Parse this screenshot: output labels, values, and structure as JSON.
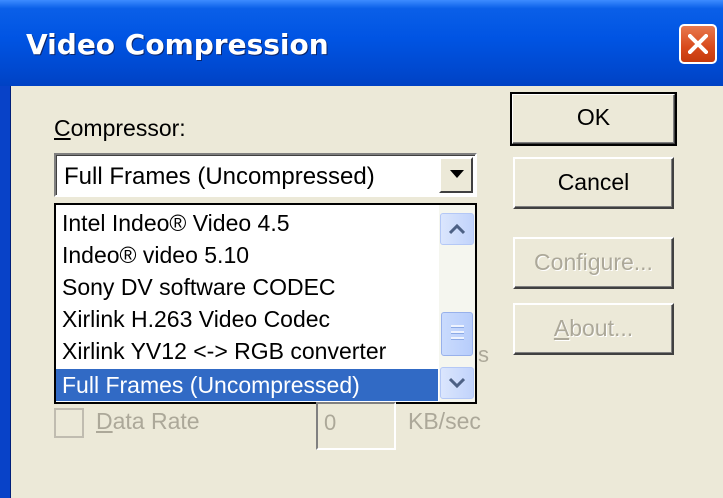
{
  "window": {
    "title": "Video Compression"
  },
  "compressor": {
    "label": "Compressor:",
    "selected_value": "Full Frames (Uncompressed)",
    "options": [
      {
        "label": "Intel Indeo® Video 4.5",
        "selected": false
      },
      {
        "label": "Indeo® video 5.10",
        "selected": false
      },
      {
        "label": "Sony DV software CODEC",
        "selected": false
      },
      {
        "label": "Xirlink H.263 Video Codec",
        "selected": false
      },
      {
        "label": "Xirlink YV12 <-> RGB converter",
        "selected": false
      },
      {
        "label": "Full Frames (Uncompressed)",
        "selected": true
      }
    ]
  },
  "buttons": {
    "ok": "OK",
    "cancel": "Cancel",
    "configure": "Configure...",
    "about": "About..."
  },
  "data_rate": {
    "label": "Data Rate",
    "value": "0",
    "unit": "KB/sec",
    "checked": false,
    "enabled": false
  },
  "hidden_fragment": "s",
  "colors": {
    "titlebar_blue": "#0054e3",
    "selection": "#316ac5",
    "dialog_face": "#ece9d8",
    "disabled_text": "#aca899"
  }
}
